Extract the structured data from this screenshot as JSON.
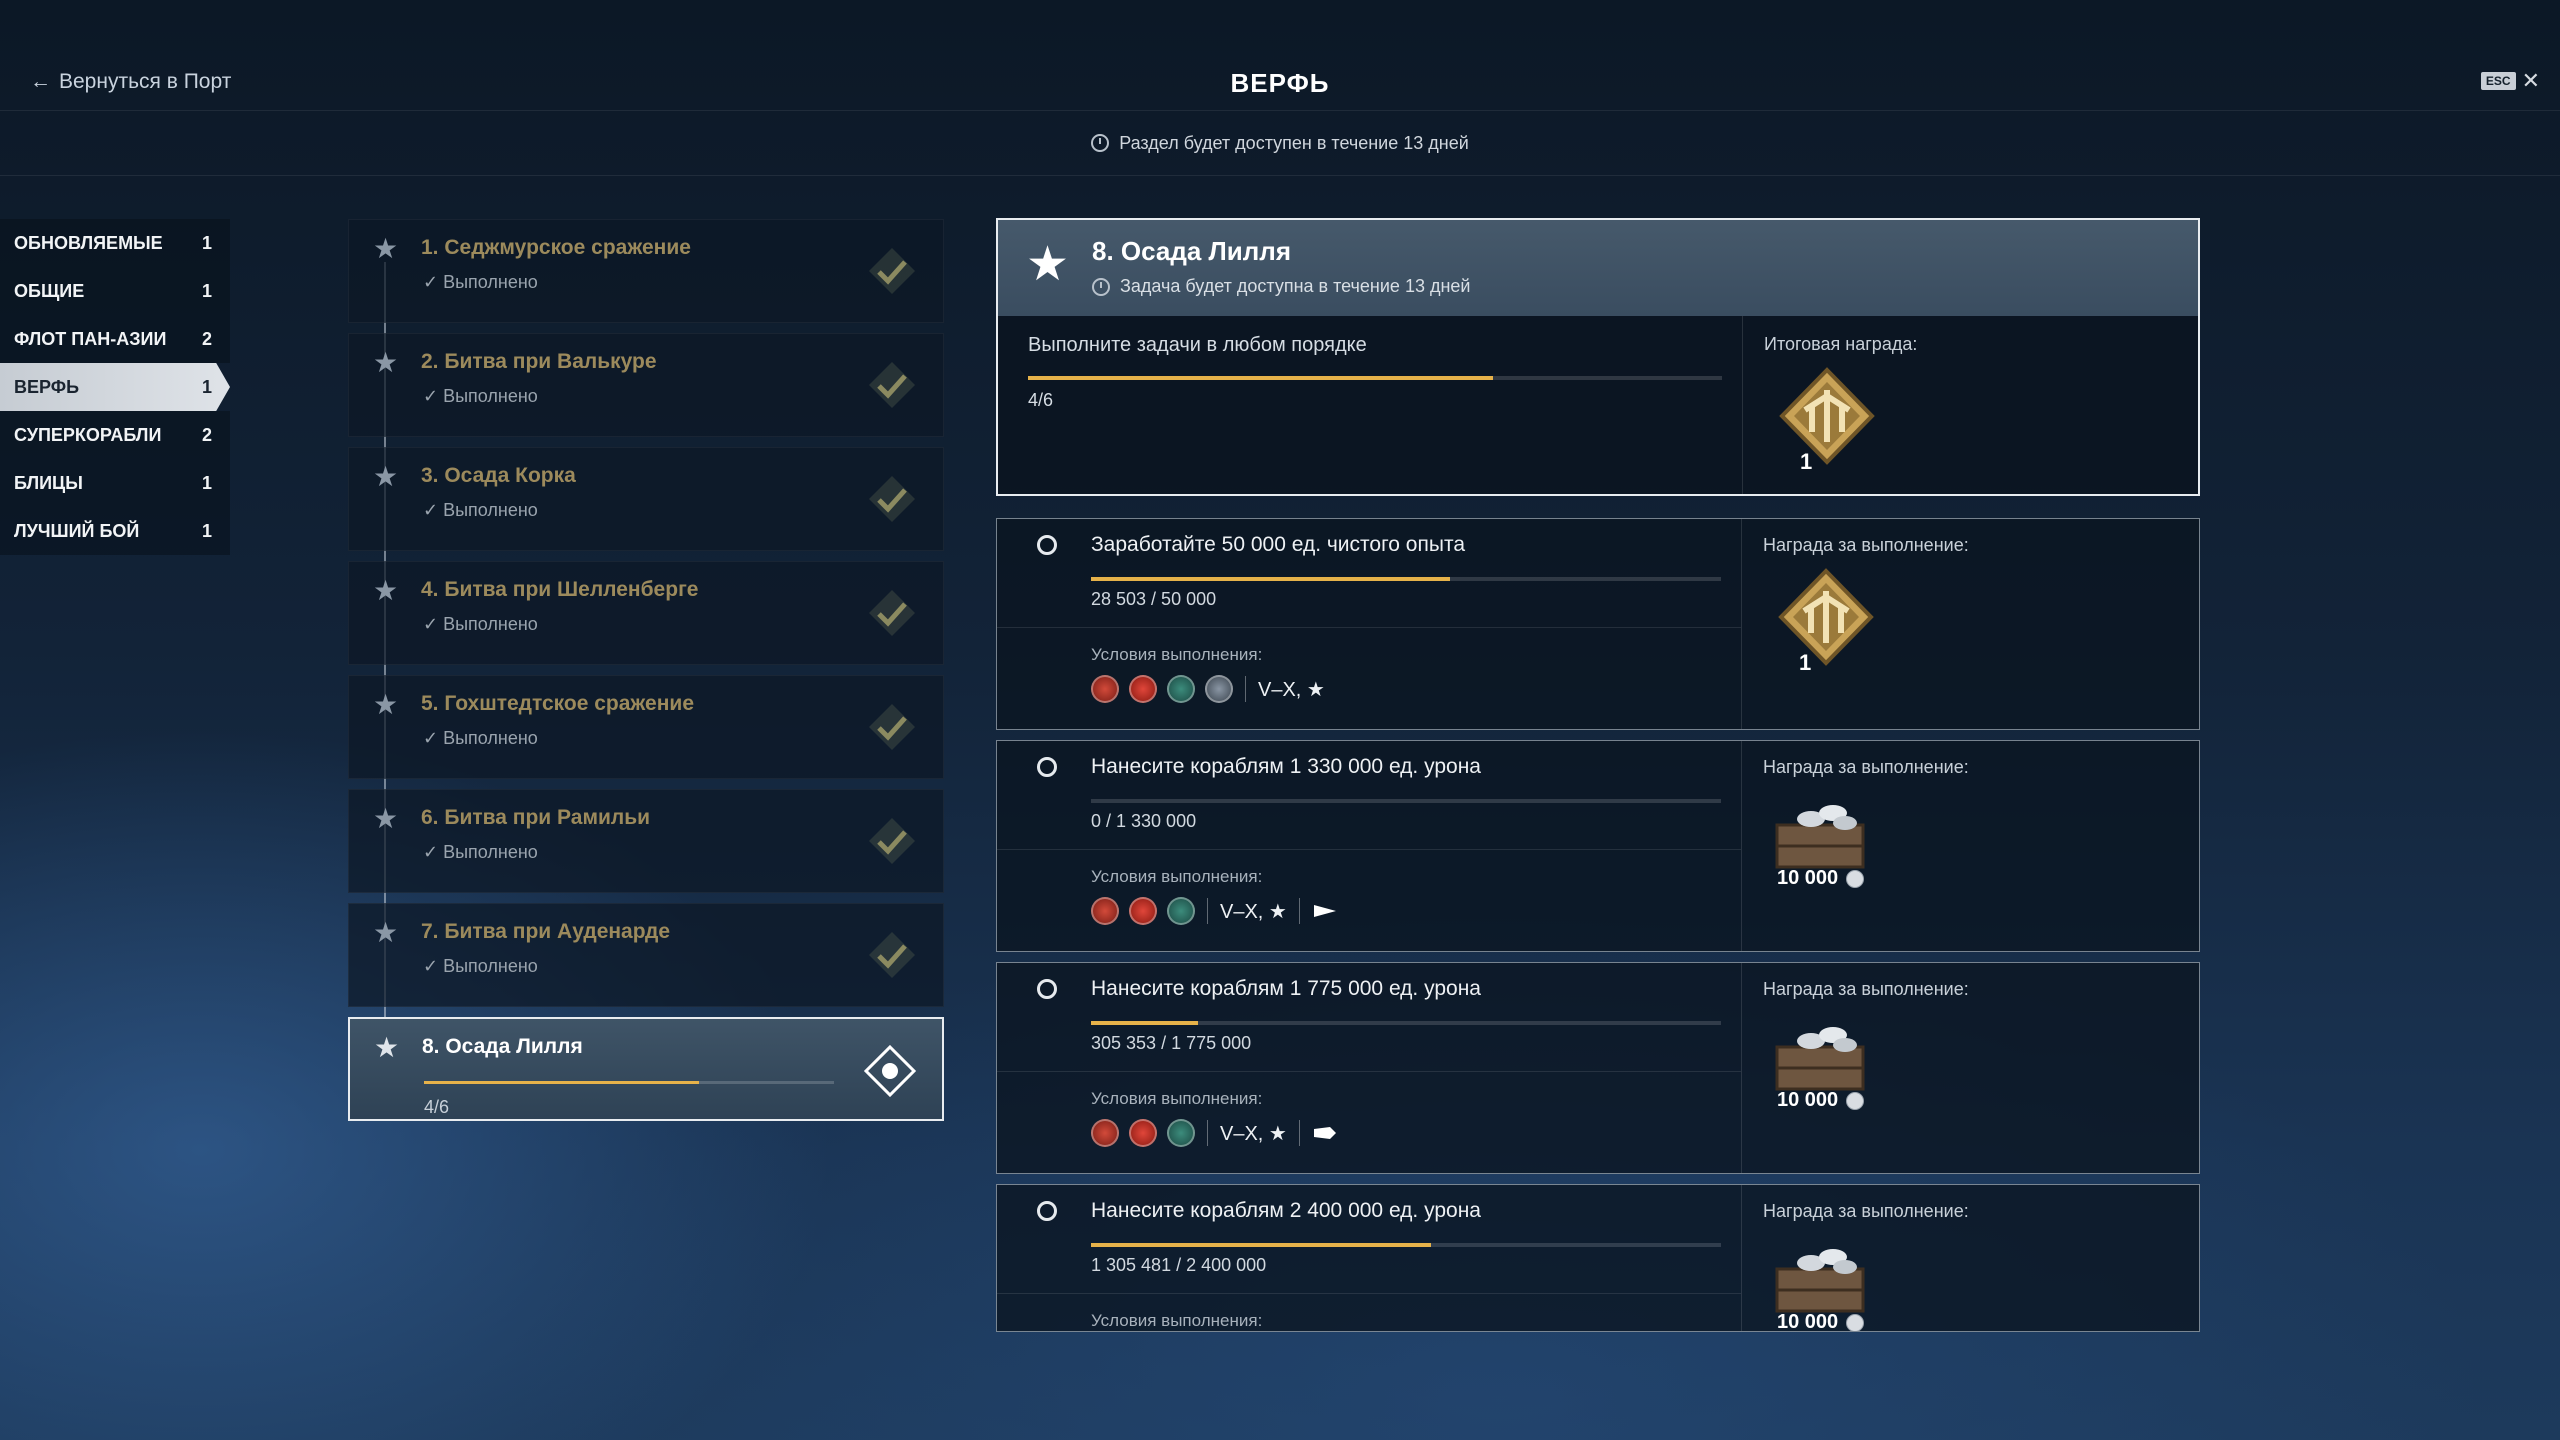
{
  "header": {
    "back_label": "Вернуться в Порт",
    "title": "ВЕРФЬ",
    "esc_label": "ESC",
    "availability": "Раздел будет доступен в течение 13 дней"
  },
  "categories": [
    {
      "label": "ОБНОВЛЯЕМЫЕ",
      "count": "1"
    },
    {
      "label": "ОБЩИЕ",
      "count": "1"
    },
    {
      "label": "ФЛОТ ПАН-АЗИИ",
      "count": "2"
    },
    {
      "label": "ВЕРФЬ",
      "count": "1",
      "active": true
    },
    {
      "label": "СУПЕРКОРАБЛИ",
      "count": "2"
    },
    {
      "label": "БЛИЦЫ",
      "count": "1"
    },
    {
      "label": "ЛУЧШИЙ БОЙ",
      "count": "1"
    }
  ],
  "stages": [
    {
      "name": "1. Седжмурское сражение",
      "status": "Выполнено"
    },
    {
      "name": "2. Битва при Валькуре",
      "status": "Выполнено"
    },
    {
      "name": "3. Осада Корка",
      "status": "Выполнено"
    },
    {
      "name": "4. Битва при Шелленберге",
      "status": "Выполнено"
    },
    {
      "name": "5. Гохштедтское сражение",
      "status": "Выполнено"
    },
    {
      "name": "6. Битва при Рамильи",
      "status": "Выполнено"
    },
    {
      "name": "7. Битва при Ауденарде",
      "status": "Выполнено"
    },
    {
      "name": "8. Осада Лилля",
      "progress": "4/6",
      "progress_fraction": 0.67,
      "active": true
    }
  ],
  "main": {
    "title": "8. Осада Лилля",
    "subtitle": "Задача будет доступна в течение 13 дней",
    "order_text": "Выполните задачи в любом порядке",
    "progress": "4/6",
    "progress_fraction": 0.67,
    "reward_label": "Итоговая награда:",
    "reward_count": "1"
  },
  "tasks": [
    {
      "text": "Заработайте 50 000 ед. чистого опыта",
      "progress_text": "28 503 / 50 000",
      "progress_fraction": 0.57,
      "cond_label": "Условия выполнения:",
      "tier": "V–X, ★",
      "reward_label": "Награда за выполнение:",
      "reward_type": "token",
      "reward_amount": "1"
    },
    {
      "text": "Нанесите кораблям 1 330 000 ед. урона",
      "progress_text": "0 / 1 330 000",
      "progress_fraction": 0.0,
      "cond_label": "Условия выполнения:",
      "tier": "V–X, ★",
      "reward_label": "Награда за выполнение:",
      "reward_type": "crate",
      "reward_amount": "10 000"
    },
    {
      "text": "Нанесите кораблям 1 775 000 ед. урона",
      "progress_text": "305 353 / 1 775 000",
      "progress_fraction": 0.17,
      "cond_label": "Условия выполнения:",
      "tier": "V–X, ★",
      "reward_label": "Награда за выполнение:",
      "reward_type": "crate",
      "reward_amount": "10 000"
    },
    {
      "text": "Нанесите кораблям 2 400 000 ед. урона",
      "progress_text": "1 305 481 / 2 400 000",
      "progress_fraction": 0.54,
      "cond_label": "Условия выполнения:",
      "tier": "",
      "reward_label": "Награда за выполнение:",
      "reward_type": "crate",
      "reward_amount": "10 000"
    }
  ],
  "colors": {
    "accent": "#e6b24a",
    "stage_text_done": "#9c8a5c"
  }
}
